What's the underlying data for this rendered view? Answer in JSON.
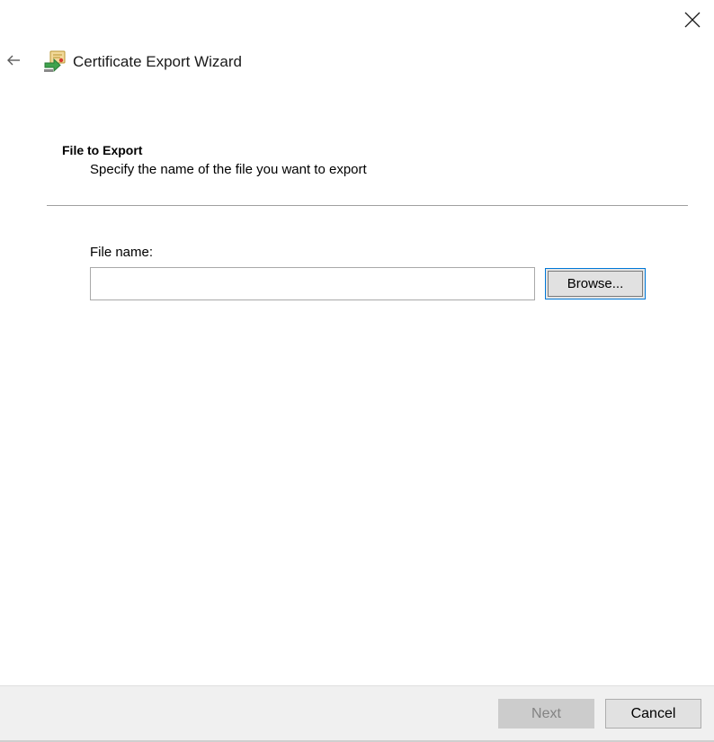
{
  "window": {
    "title": "Certificate Export Wizard",
    "icon": "certificate-wizard-icon"
  },
  "controls": {
    "close_icon": "close-icon",
    "back_icon": "back-arrow-icon"
  },
  "header": {
    "section_title": "File to Export",
    "section_subtitle": "Specify the name of the file you want to export"
  },
  "form": {
    "file_name_label": "File name:",
    "file_name_value": "",
    "browse_label": "Browse..."
  },
  "footer": {
    "next_label": "Next",
    "next_enabled": false,
    "cancel_label": "Cancel"
  },
  "colors": {
    "focus_border": "#0078d7",
    "footer_bg": "#f0f0f0",
    "disabled_text": "#838383"
  }
}
